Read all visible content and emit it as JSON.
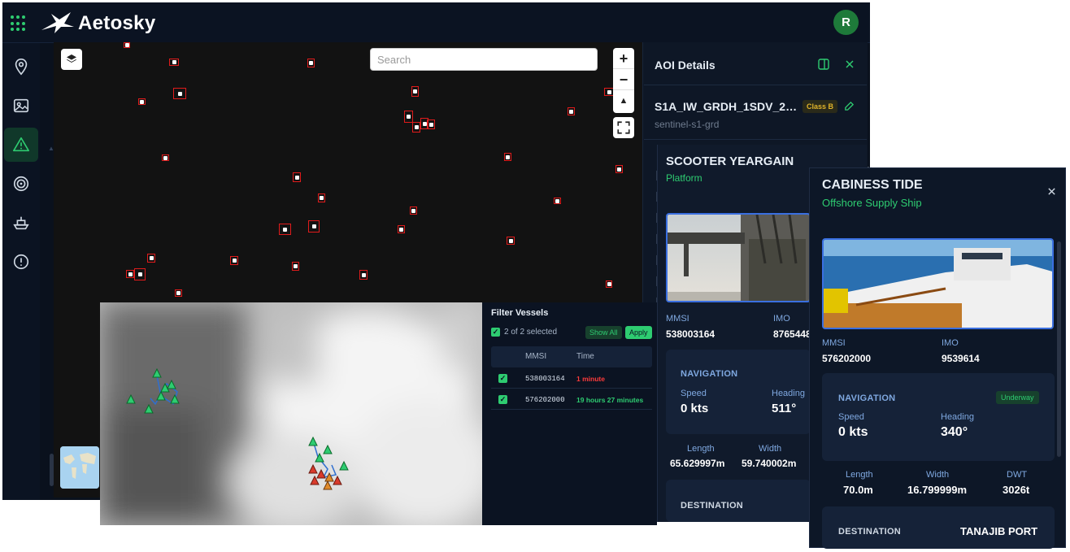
{
  "header": {
    "app_name": "Aetosky",
    "user_initial": "R"
  },
  "sidebar": {
    "items": [
      {
        "icon": "location-pin-icon",
        "active": false
      },
      {
        "icon": "image-icon",
        "active": false
      },
      {
        "icon": "alert-triangle-icon",
        "active": true
      },
      {
        "icon": "target-icon",
        "active": false
      },
      {
        "icon": "ship-icon",
        "active": false
      },
      {
        "icon": "info-circle-icon",
        "active": false
      }
    ]
  },
  "map": {
    "search_placeholder": "Search",
    "zoom_in": "+",
    "zoom_out": "−",
    "compass": "▲"
  },
  "aoi_panel": {
    "title": "AOI Details",
    "scene_name": "S1A_IW_GRDH_1SDV_2025...",
    "class_badge": "Class B",
    "scene_source": "sentinel-s1-grd"
  },
  "scooter_card": {
    "name": "SCOOTER YEARGAIN",
    "type": "Platform",
    "mmsi_label": "MMSI",
    "mmsi": "538003164",
    "imo_label": "IMO",
    "imo": "8765448",
    "navigation_title": "NAVIGATION",
    "speed_label": "Speed",
    "speed": "0 kts",
    "heading_label": "Heading",
    "heading": "511°",
    "length_label": "Length",
    "length": "65.629997m",
    "width_label": "Width",
    "width": "59.740002m",
    "destination_label": "DESTINATION"
  },
  "cabiness_card": {
    "name": "CABINESS TIDE",
    "type": "Offshore Supply Ship",
    "mmsi_label": "MMSI",
    "mmsi": "576202000",
    "imo_label": "IMO",
    "imo": "9539614",
    "navigation_title": "NAVIGATION",
    "nav_status": "Underway",
    "speed_label": "Speed",
    "speed": "0 kts",
    "heading_label": "Heading",
    "heading": "340°",
    "length_label": "Length",
    "length": "70.0m",
    "width_label": "Width",
    "width": "16.799999m",
    "dwt_label": "DWT",
    "dwt": "3026t",
    "destination_label": "DESTINATION",
    "destination": "TANAJIB PORT"
  },
  "filter_vessels": {
    "title": "Filter Vessels",
    "selected_text": "2 of 2 selected",
    "show_all_label": "Show All",
    "apply_label": "Apply",
    "columns": [
      "MMSI",
      "Time"
    ],
    "rows": [
      {
        "mmsi": "538003164",
        "time": "1 minute",
        "time_color": "#ff3b3b"
      },
      {
        "mmsi": "576202000",
        "time": "19 hours 27 minutes",
        "time_color": "#2ecc71"
      }
    ]
  },
  "colors": {
    "accent": "#2ecc71",
    "detection_box": "#e01b1b",
    "background": "#0a111d",
    "class_badge": "#e0b32a"
  }
}
